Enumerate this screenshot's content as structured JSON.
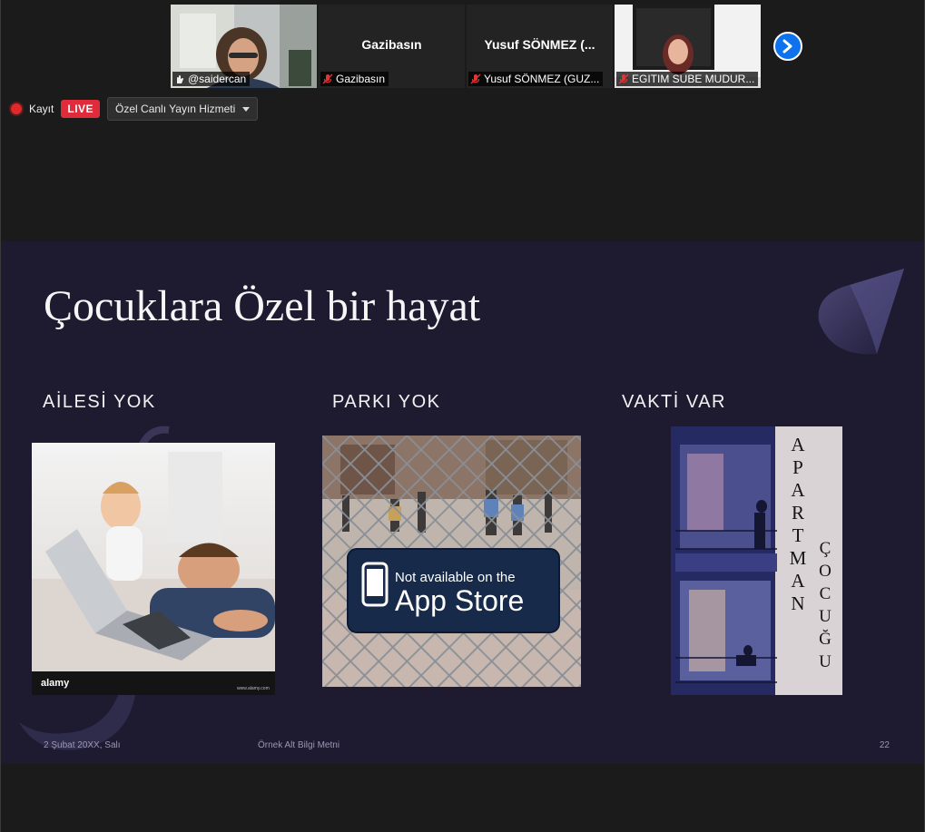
{
  "participants": [
    {
      "name": "@saidercan",
      "active": true,
      "mic": "hand-icon"
    },
    {
      "display_name": "Gazibasın",
      "name": "Gazibasın",
      "mic": "mic-muted-icon"
    },
    {
      "display_name": "Yusuf SÖNMEZ (...",
      "name": "Yusuf SÖNMEZ (GUZ...",
      "mic": "mic-muted-icon"
    },
    {
      "name": "EGITIM SUBE MUDUR...",
      "mic": "mic-muted-icon"
    }
  ],
  "recording": {
    "label": "Kayıt",
    "live_badge": "LIVE",
    "stream_service": "Özel Canlı Yayın Hizmeti"
  },
  "slide": {
    "title": "Çocuklara Özel bir hayat",
    "columns": [
      {
        "heading": "AİLESİ YOK"
      },
      {
        "heading": "PARKI YOK",
        "sign_line1": "Not available on the",
        "sign_line2": "App Store"
      },
      {
        "heading": "VAKTİ VAR",
        "poster_word1": "APARTMAN",
        "poster_word2": "ÇOCUĞU"
      }
    ],
    "stock_watermark": "alamy",
    "stock_url": "www.alamy.com",
    "footer_date": "2 Şubat 20XX, Salı",
    "footer_text": "Örnek Alt Bilgi Metni",
    "page_number": "22"
  },
  "colors": {
    "slide_bg": "#1e1a30",
    "live_red": "#e02b3a",
    "active_speaker": "#a2c523",
    "next_button": "#0e72ed"
  }
}
